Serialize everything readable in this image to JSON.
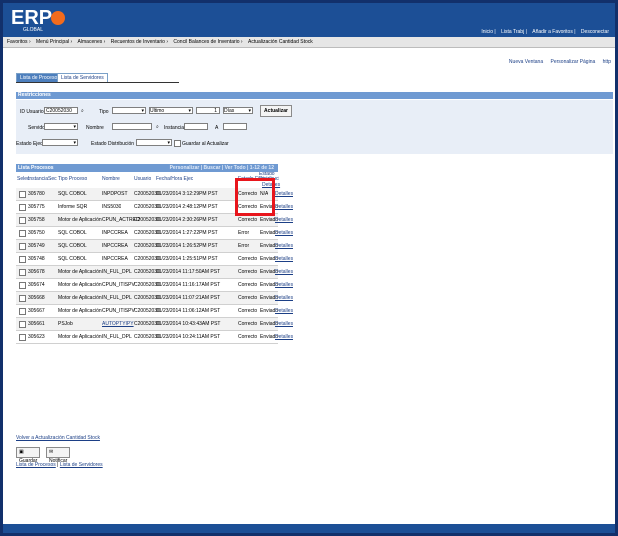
{
  "header": {
    "logo": "ERP",
    "logo_sub": "GLOBAL",
    "links": [
      "Inicio",
      "Lista Trabj",
      "Añadir a Favoritos",
      "Desconectar"
    ]
  },
  "nav": [
    "Favoritos",
    "Menú Principal",
    "Almacenes",
    "Recuentos de Inventario",
    "Concil Balances de Inventario",
    "Actualización Cantidad Stock"
  ],
  "page_links": [
    "Nueva Ventana",
    "Personalizar Página",
    "http"
  ],
  "tabs": {
    "process": "Lista de Procesos",
    "servers": "Lista de Servidores"
  },
  "filters": {
    "title": "Restricciones",
    "user_label": "ID Usuario",
    "user_value": "C20052030",
    "type_label": "Tipo",
    "last_value": "Ultimo",
    "count_value": "1",
    "days_value": "Días",
    "refresh_label": "Actualizar",
    "server_label": "Servidor",
    "name_label": "Nombre",
    "instance_label": "Instancia",
    "to_label": "A",
    "status_label": "Estado Ejec",
    "dist_label": "Estado Distribución",
    "save_label": "Guardar al Actualizar"
  },
  "list": {
    "title": "Lista Procesos",
    "nav": "Personalizar | Buscar | Ver Todo | 1-12 de 12",
    "columns": [
      "Selec",
      "Instancia",
      "Sec",
      "Tipo Proceso",
      "Nombre",
      "Usuario",
      "Fecha/Hora Ejec",
      "Estado Ejec",
      "Estado Distribución",
      "Detalles"
    ],
    "rows": [
      {
        "id": "305780",
        "type": "SQL COBOL",
        "name": "INPDPOST",
        "user": "C20052030",
        "dt": "01/23/2014 3:12:29PM PST",
        "status": "Correcto",
        "dist": "N/A",
        "det": "Detalles"
      },
      {
        "id": "305775",
        "type": "Informe SQR",
        "name": "INS5030",
        "user": "C20052030",
        "dt": "01/23/2014 2:48:12PM PST",
        "status": "Correcto",
        "dist": "Enviado",
        "det": "Detalles"
      },
      {
        "id": "305758",
        "type": "Motor de Aplicación",
        "name": "CPUN_ACTREO",
        "user": "C20052030",
        "dt": "01/23/2014 2:30:26PM PST",
        "status": "Correcto",
        "dist": "Enviado",
        "det": "Detalles"
      },
      {
        "id": "305750",
        "type": "SQL COBOL",
        "name": "INPCCREA",
        "user": "C20052030",
        "dt": "01/23/2014 1:27:22PM PST",
        "status": "Error",
        "dist": "Enviado",
        "det": "Detalles"
      },
      {
        "id": "305749",
        "type": "SQL COBOL",
        "name": "INPCCREA",
        "user": "C20052030",
        "dt": "01/23/2014 1:26:52PM PST",
        "status": "Error",
        "dist": "Enviado",
        "det": "Detalles"
      },
      {
        "id": "305748",
        "type": "SQL COBOL",
        "name": "INPCCREA",
        "user": "C20052030",
        "dt": "01/23/2014 1:25:51PM PST",
        "status": "Correcto",
        "dist": "Enviado",
        "det": "Detalles"
      },
      {
        "id": "305678",
        "type": "Motor de Aplicación",
        "name": "IN_FUL_DPL",
        "user": "C20052030",
        "dt": "01/23/2014 11:17:50AM PST",
        "status": "Correcto",
        "dist": "Enviado",
        "det": "Detalles"
      },
      {
        "id": "305674",
        "type": "Motor de Aplicación",
        "name": "CPUN_ITISPV",
        "user": "C20052030",
        "dt": "01/23/2014 11:16:17AM PST",
        "status": "Correcto",
        "dist": "Enviado",
        "det": "Detalles"
      },
      {
        "id": "305668",
        "type": "Motor de Aplicación",
        "name": "IN_FUL_DPL",
        "user": "C20052030",
        "dt": "01/23/2014 11:07:21AM PST",
        "status": "Correcto",
        "dist": "Enviado",
        "det": "Detalles"
      },
      {
        "id": "305667",
        "type": "Motor de Aplicación",
        "name": "CPUN_ITISPV",
        "user": "C20052030",
        "dt": "01/23/2014 11:06:12AM PST",
        "status": "Correcto",
        "dist": "Enviado",
        "det": "Detalles"
      },
      {
        "id": "305661",
        "type": "PSJob",
        "name": "AUTOPTYIPY",
        "user": "C20052030",
        "dt": "01/23/2014 10:43:43AM PST",
        "status": "Correcto",
        "dist": "Enviado",
        "det": "Detalles"
      },
      {
        "id": "305623",
        "type": "Motor de Aplicación",
        "name": "IN_FUL_DPL",
        "user": "C20052030",
        "dt": "01/23/2014 10:24:11AM PST",
        "status": "Correcto",
        "dist": "Enviado",
        "det": "Detalles"
      }
    ]
  },
  "bottom": {
    "back_link": "Volver a Actualización Cantidad Stock",
    "save": "Guardar",
    "notify": "Notificar",
    "link1": "Lista de Procesos",
    "link2": "Lista de Servidores"
  }
}
